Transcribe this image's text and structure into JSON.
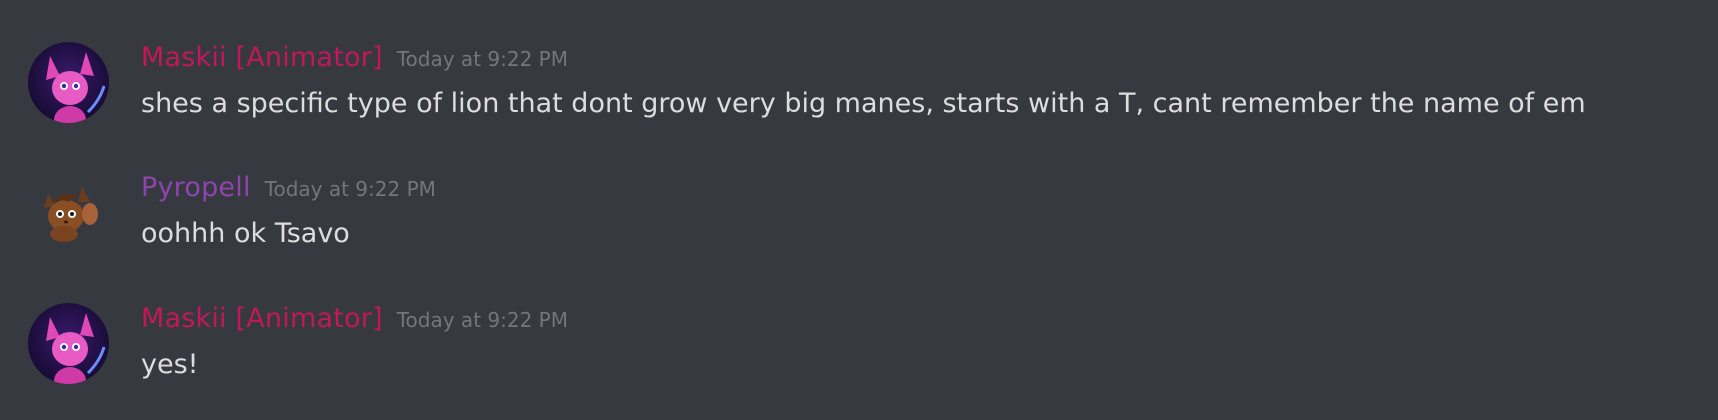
{
  "colors": {
    "background": "#36393f",
    "maskii_role": "#c2185b",
    "pyropell_role": "#8e44ad",
    "timestamp": "#72767d",
    "text": "#dcddde"
  },
  "messages": [
    {
      "author": "Maskii [Animator]",
      "timestamp": "Today at 9:22 PM",
      "content": "shes a specific type of lion that dont grow very big manes, starts with a T, cant remember the name of em",
      "avatar_icon": "pink-fox-character-avatar"
    },
    {
      "author": "Pyropell",
      "timestamp": "Today at 9:22 PM",
      "content": "oohhh ok Tsavo",
      "avatar_icon": "brown-cat-character-avatar"
    },
    {
      "author": "Maskii [Animator]",
      "timestamp": "Today at 9:22 PM",
      "content": "yes!",
      "avatar_icon": "pink-fox-character-avatar"
    }
  ]
}
